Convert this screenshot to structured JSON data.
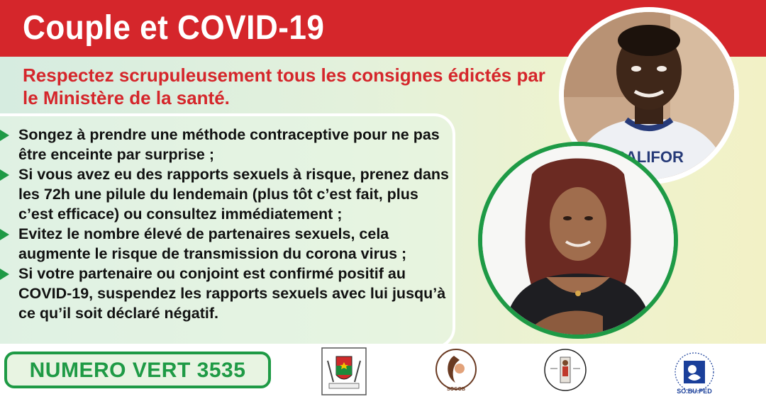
{
  "header": {
    "title": "Couple et COVID-19"
  },
  "subtitle": "Respectez scrupuleusement tous les consignes édictés par le Ministère de la santé.",
  "bullets": [
    "Songez à prendre une méthode contraceptive pour ne pas être enceinte par surprise ;",
    "Si vous avez eu des rapports sexuels à risque, prenez dans les 72h une pilule du lendemain (plus tôt c’est fait, plus c’est efficace) ou consultez immédiatement ;",
    "Evitez le nombre élevé de partenaires sexuels, cela augmente le risque de transmission du corona virus ;",
    "Si votre partenaire ou conjoint est confirmé positif au COVID-19, suspendez les rapports sexuels avec lui jusqu’à ce qu’il soit déclaré négatif."
  ],
  "photos": {
    "man_shirt_text": "CALIFOR"
  },
  "footer": {
    "hotline": "NUMERO VERT 3535",
    "logos": {
      "sobuped_caption": "SO.BU.PED",
      "sogob_caption": "SOGOB"
    }
  },
  "colors": {
    "header_red": "#d5262b",
    "accent_green": "#1e9a45"
  }
}
